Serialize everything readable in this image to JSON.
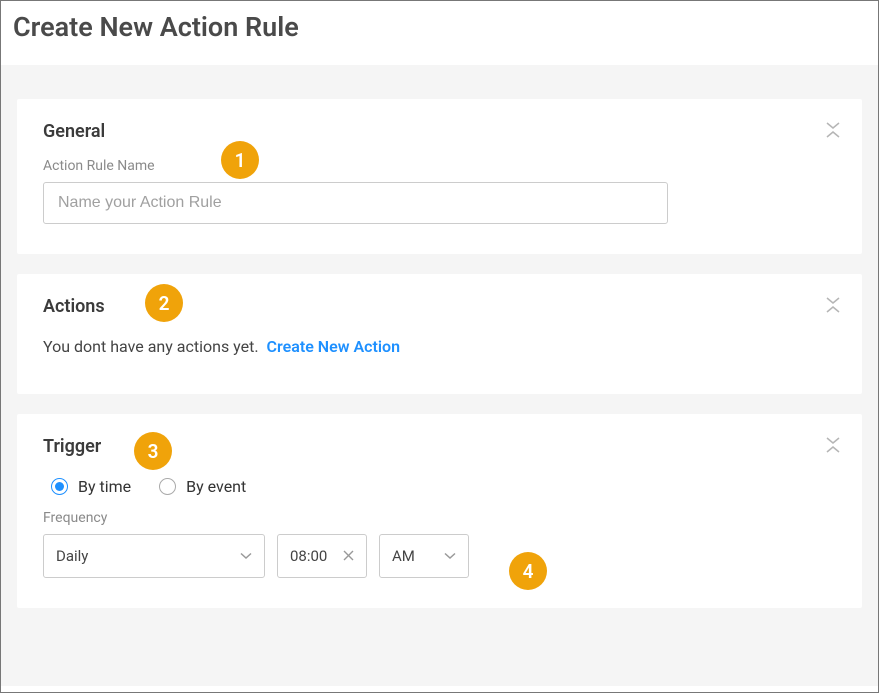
{
  "page": {
    "title": "Create New Action Rule"
  },
  "markers": {
    "m1": "1",
    "m2": "2",
    "m3": "3",
    "m4": "4"
  },
  "general": {
    "title": "General",
    "nameLabel": "Action Rule Name",
    "namePlaceholder": "Name your Action Rule",
    "nameValue": ""
  },
  "actions": {
    "title": "Actions",
    "emptyText": "You dont have any actions yet.",
    "createLink": "Create New Action"
  },
  "trigger": {
    "title": "Trigger",
    "radios": {
      "byTime": "By time",
      "byEvent": "By event"
    },
    "selectedRadio": "byTime",
    "frequencyLabel": "Frequency",
    "frequencyValue": "Daily",
    "timeValue": "08:00",
    "ampmValue": "AM"
  }
}
